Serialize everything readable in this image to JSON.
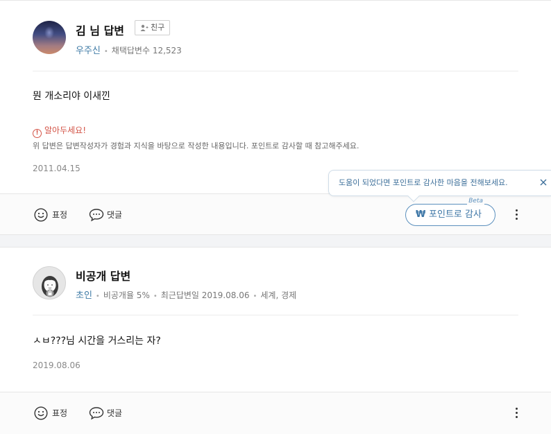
{
  "answers": [
    {
      "author": "김 님 답변",
      "friend_label": "친구",
      "rank": "우주신",
      "stat_label": "채택답변수",
      "stat_value": "12,523",
      "body": "뭔 개소리야 이새낀",
      "notice_title": "알아두세요!",
      "notice_text": "위 답변은 답변작성자가 경험과 지식을 바탕으로 작성한 내용입니다. 포인트로 감사할 때 참고해주세요.",
      "date": "2011.04.15",
      "emotion_label": "표정",
      "comment_label": "댓글",
      "thanks_label": "포인트로 감사",
      "thanks_beta": "Beta",
      "tooltip": "도움이 되었다면 포인트로 감사한 마음을 전해보세요."
    },
    {
      "author": "비공개 답변",
      "rank": "초인",
      "private_rate": "비공개율 5%",
      "recent": "최근답변일 2019.08.06",
      "category": "세계, 경제",
      "body": "ㅅㅂ???님 시간을 거스리는 자?",
      "date": "2019.08.06",
      "emotion_label": "표정",
      "comment_label": "댓글"
    }
  ],
  "colors": {
    "accent": "#3d76a6",
    "warning": "#d35447",
    "divider_bg": "#f3f4f6"
  }
}
